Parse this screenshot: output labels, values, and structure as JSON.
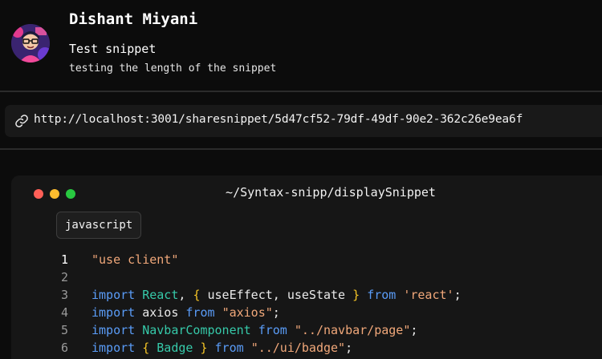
{
  "author": {
    "name": "Dishant Miyani",
    "avatar": "avatar-illustration"
  },
  "snippet": {
    "title": "Test snippet",
    "description": "testing the length of the snippet"
  },
  "share": {
    "icon": "link-icon",
    "url": "http://localhost:3001/sharesnippet/5d47cf52-79df-49df-90e2-362c26e9ea6f"
  },
  "editor": {
    "window_controls": [
      "close",
      "minimize",
      "maximize"
    ],
    "path": "~/Syntax-snipp/displaySnippet",
    "language": "javascript",
    "active_line": 1,
    "lines": [
      {
        "number": "1",
        "tokens": [
          {
            "t": "\"use client\"",
            "k": "str"
          }
        ]
      },
      {
        "number": "2",
        "tokens": []
      },
      {
        "number": "3",
        "tokens": [
          {
            "t": "import",
            "k": "kw"
          },
          {
            "t": " ",
            "k": "plain"
          },
          {
            "t": "React",
            "k": "comp"
          },
          {
            "t": ", ",
            "k": "plain"
          },
          {
            "t": "{",
            "k": "brace"
          },
          {
            "t": " useEffect, useState ",
            "k": "plain"
          },
          {
            "t": "}",
            "k": "brace"
          },
          {
            "t": " ",
            "k": "plain"
          },
          {
            "t": "from",
            "k": "kw"
          },
          {
            "t": " ",
            "k": "plain"
          },
          {
            "t": "'react'",
            "k": "str"
          },
          {
            "t": ";",
            "k": "plain"
          }
        ]
      },
      {
        "number": "4",
        "tokens": [
          {
            "t": "import",
            "k": "kw"
          },
          {
            "t": " axios ",
            "k": "plain"
          },
          {
            "t": "from",
            "k": "kw"
          },
          {
            "t": " ",
            "k": "plain"
          },
          {
            "t": "\"axios\"",
            "k": "str"
          },
          {
            "t": ";",
            "k": "plain"
          }
        ]
      },
      {
        "number": "5",
        "tokens": [
          {
            "t": "import",
            "k": "kw"
          },
          {
            "t": " ",
            "k": "plain"
          },
          {
            "t": "NavbarComponent",
            "k": "comp"
          },
          {
            "t": " ",
            "k": "plain"
          },
          {
            "t": "from",
            "k": "kw"
          },
          {
            "t": " ",
            "k": "plain"
          },
          {
            "t": "\"../navbar/page\"",
            "k": "str"
          },
          {
            "t": ";",
            "k": "plain"
          }
        ]
      },
      {
        "number": "6",
        "tokens": [
          {
            "t": "import",
            "k": "kw"
          },
          {
            "t": " ",
            "k": "plain"
          },
          {
            "t": "{",
            "k": "brace"
          },
          {
            "t": " ",
            "k": "plain"
          },
          {
            "t": "Badge",
            "k": "comp"
          },
          {
            "t": " ",
            "k": "plain"
          },
          {
            "t": "}",
            "k": "brace"
          },
          {
            "t": " ",
            "k": "plain"
          },
          {
            "t": "from",
            "k": "kw"
          },
          {
            "t": " ",
            "k": "plain"
          },
          {
            "t": "\"../ui/badge\"",
            "k": "str"
          },
          {
            "t": ";",
            "k": "plain"
          }
        ]
      }
    ]
  },
  "colors": {
    "background": "#0c0c0c",
    "panel": "#161616",
    "string": "#f1a87a",
    "keyword": "#5a9cf7",
    "component": "#36c9a9",
    "brace": "#f6c526"
  }
}
